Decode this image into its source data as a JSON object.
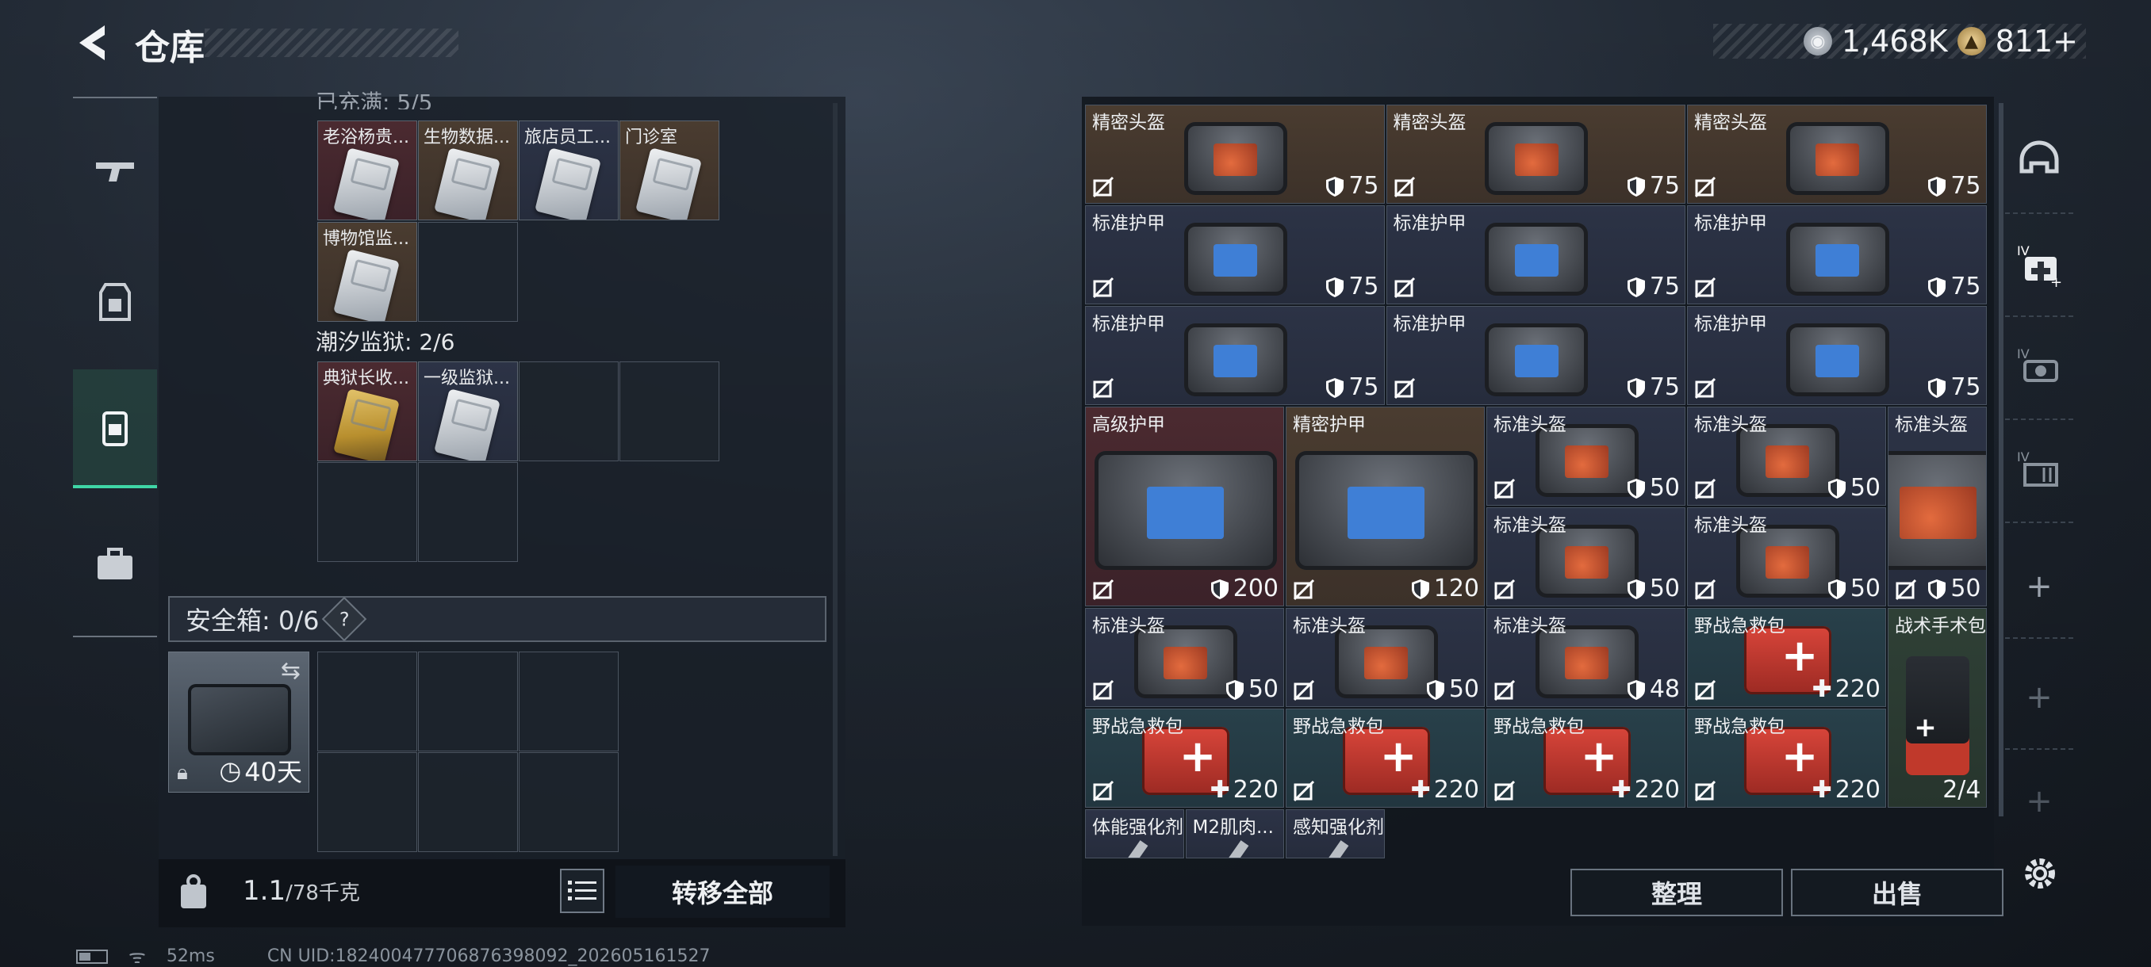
{
  "header": {
    "title": "仓库",
    "currency1": "1,468K",
    "currency2": "811+",
    "currency1_icon": "silver-coin-icon",
    "currency2_icon": "gold-coin-icon"
  },
  "left_nav": {
    "items": [
      "gun-icon",
      "armor-icon",
      "backpack-icon",
      "briefcase-icon"
    ],
    "active_index": 2
  },
  "left_panel": {
    "top_cut_label": "已充满: 5/5",
    "group1": {
      "items": [
        {
          "name": "老浴杨贵...",
          "color": "red"
        },
        {
          "name": "生物数据...",
          "color": "brown"
        },
        {
          "name": "旅店员工...",
          "color": "navy"
        },
        {
          "name": "门诊室",
          "color": "brown"
        },
        {
          "name": "博物馆监...",
          "color": "brown"
        }
      ]
    },
    "group2": {
      "label": "潮汐监狱: 2/6",
      "items": [
        {
          "name": "典狱长收...",
          "color": "red"
        },
        {
          "name": "一级监狱...",
          "color": "navy"
        }
      ]
    },
    "safe_box": {
      "label": "安全箱: 0/6",
      "help": "?",
      "duration": "40天"
    },
    "weight": {
      "current": "1.1",
      "max": "/78千克"
    },
    "transfer_all": "转移全部"
  },
  "status_bar": {
    "ping": "52ms",
    "uid": "CN UID:182400477706876398092_202605161527"
  },
  "right_panel": {
    "items": [
      {
        "name": "精密头盔",
        "val": "75",
        "bg": "brown",
        "art": "helmet"
      },
      {
        "name": "精密头盔",
        "val": "75",
        "bg": "brown",
        "art": "helmet"
      },
      {
        "name": "精密头盔",
        "val": "75",
        "bg": "brown",
        "art": "helmet"
      },
      {
        "name": "标准护甲",
        "val": "75",
        "bg": "navy",
        "art": "armor"
      },
      {
        "name": "标准护甲",
        "val": "75",
        "bg": "navy",
        "art": "armor"
      },
      {
        "name": "标准护甲",
        "val": "75",
        "bg": "navy",
        "art": "armor"
      },
      {
        "name": "标准护甲",
        "val": "75",
        "bg": "navy",
        "art": "armor"
      },
      {
        "name": "标准护甲",
        "val": "75",
        "bg": "navy",
        "art": "armor"
      },
      {
        "name": "标准护甲",
        "val": "75",
        "bg": "navy",
        "art": "armor"
      },
      {
        "name": "高级护甲",
        "val": "200",
        "bg": "red",
        "art": "armor"
      },
      {
        "name": "精密护甲",
        "val": "120",
        "bg": "brown",
        "art": "armor"
      },
      {
        "name": "标准头盔",
        "val": "50",
        "bg": "navy",
        "art": "helmet"
      },
      {
        "name": "标准头盔",
        "val": "50",
        "bg": "navy",
        "art": "helmet"
      },
      {
        "name": "标准头盔",
        "val": "50",
        "bg": "navy",
        "art": "helmet"
      },
      {
        "name": "标准头盔",
        "val": "50",
        "bg": "navy",
        "art": "helmet"
      },
      {
        "name": "标准头盔",
        "val": "50",
        "bg": "navy",
        "art": "helmet"
      },
      {
        "name": "标准头盔",
        "val": "50",
        "bg": "navy",
        "art": "helmet"
      },
      {
        "name": "标准头盔",
        "val": "50",
        "bg": "navy",
        "art": "helmet"
      },
      {
        "name": "标准头盔",
        "val": "48",
        "bg": "navy",
        "art": "helmet"
      },
      {
        "name": "野战急救包",
        "val": "220",
        "bg": "teal",
        "art": "kit"
      },
      {
        "name": "战术手术包",
        "val": "2/4",
        "bg": "green",
        "art": "surgery"
      },
      {
        "name": "野战急救包",
        "val": "220",
        "bg": "teal",
        "art": "kit"
      },
      {
        "name": "野战急救包",
        "val": "220",
        "bg": "teal",
        "art": "kit"
      },
      {
        "name": "野战急救包",
        "val": "220",
        "bg": "teal",
        "art": "kit"
      },
      {
        "name": "野战急救包",
        "val": "220",
        "bg": "teal",
        "art": "kit"
      },
      {
        "name": "体能强化剂",
        "val": "",
        "bg": "navy",
        "art": "syringe"
      },
      {
        "name": "M2肌肉...",
        "val": "",
        "bg": "navy",
        "art": "syringe"
      },
      {
        "name": "感知强化剂",
        "val": "",
        "bg": "navy",
        "art": "syringe"
      }
    ],
    "sort_label": "整理",
    "sell_label": "出售"
  },
  "right_nav": {
    "items": [
      "helmet-slot-icon",
      "medkit-iv-icon",
      "armor-iv-icon",
      "storage-iv-icon",
      "add-icon",
      "add-icon",
      "add-icon"
    ]
  }
}
